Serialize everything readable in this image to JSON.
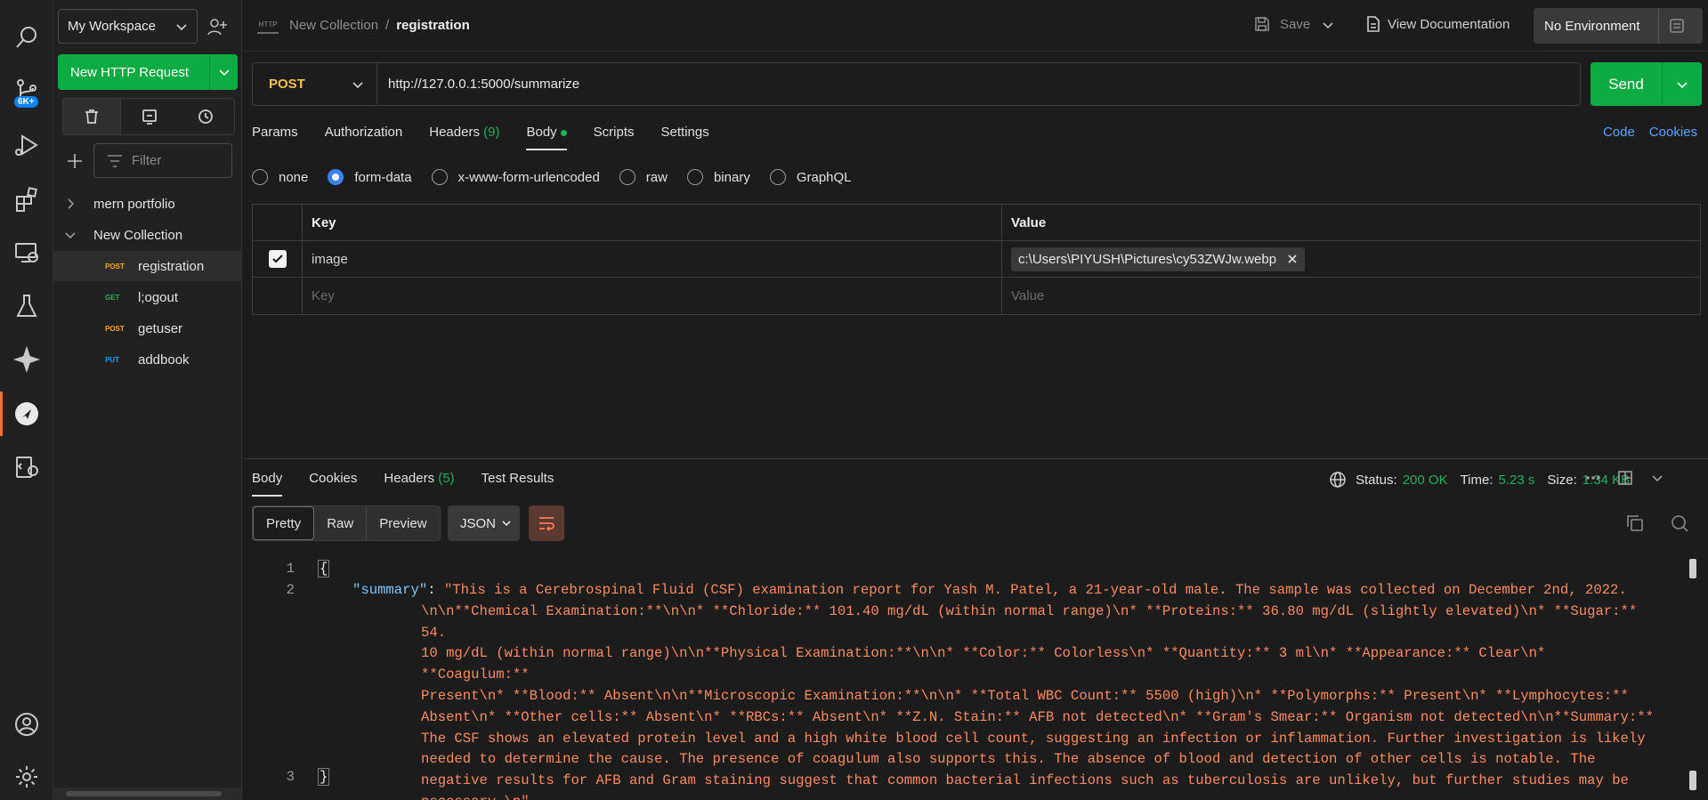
{
  "workspace": {
    "name": "My Workspace",
    "badge": "6K+"
  },
  "sidebar": {
    "new_button": "New HTTP Request",
    "filter_placeholder": "Filter",
    "tree": [
      {
        "type": "collection",
        "name": "mern portfolio",
        "expanded": false
      },
      {
        "type": "collection",
        "name": "New Collection",
        "expanded": true
      },
      {
        "type": "request",
        "method": "POST",
        "name": "registration",
        "selected": true
      },
      {
        "type": "request",
        "method": "GET",
        "name": "l;ogout"
      },
      {
        "type": "request",
        "method": "POST",
        "name": "getuser"
      },
      {
        "type": "request",
        "method": "PUT",
        "name": "addbook"
      }
    ]
  },
  "header": {
    "breadcrumb_icon": "HTTP",
    "collection": "New Collection",
    "separator": "/",
    "request": "registration",
    "save": "Save",
    "view_docs": "View Documentation",
    "environment": "No Environment"
  },
  "request": {
    "method": "POST",
    "url": "http://127.0.0.1:5000/summarize",
    "send": "Send",
    "tabs": {
      "params": "Params",
      "authorization": "Authorization",
      "headers": "Headers",
      "headers_count": "(9)",
      "body": "Body",
      "scripts": "Scripts",
      "settings": "Settings"
    },
    "links": {
      "code": "Code",
      "cookies": "Cookies"
    },
    "body_types": [
      "none",
      "form-data",
      "x-www-form-urlencoded",
      "raw",
      "binary",
      "GraphQL"
    ],
    "body_selected": "form-data",
    "table": {
      "key_header": "Key",
      "value_header": "Value",
      "row_key": "image",
      "row_value": "c:\\Users\\PIYUSH\\Pictures\\cy53ZWJw.webp",
      "key_placeholder": "Key",
      "value_placeholder": "Value"
    }
  },
  "response": {
    "tabs": {
      "body": "Body",
      "cookies": "Cookies",
      "headers": "Headers",
      "headers_count": "(5)",
      "test_results": "Test Results"
    },
    "status_label": "Status:",
    "status_value": "200 OK",
    "time_label": "Time:",
    "time_value": "5.23 s",
    "size_label": "Size:",
    "size_value": "1.34 KB",
    "views": [
      "Pretty",
      "Raw",
      "Preview"
    ],
    "format": "JSON",
    "code": {
      "ln1": "1",
      "ln2": "2",
      "ln3": "3",
      "open": "{",
      "close": "}",
      "key": "\"summary\"",
      "colon": ": ",
      "lines": [
        "\"This is a Cerebrospinal Fluid (CSF) examination report for Yash M. Patel, a 21-year-old male.  The sample was collected on December 2nd, 2022.",
        "\\n\\n**Chemical Examination:**\\n\\n* **Chloride:** 101.40 mg/dL (within normal range)\\n* **Proteins:** 36.80 mg/dL (slightly elevated)\\n* **Sugar:** 54.",
        "10 mg/dL (within normal range)\\n\\n**Physical Examination:**\\n\\n* **Color:** Colorless\\n* **Quantity:** 3 ml\\n* **Appearance:** Clear\\n* **Coagulum:**",
        "Present\\n* **Blood:** Absent\\n\\n**Microscopic Examination:**\\n\\n* **Total WBC Count:** 5500 (high)\\n* **Polymorphs:** Present\\n* **Lymphocytes:**",
        "Absent\\n* **Other cells:** Absent\\n* **RBCs:** Absent\\n* **Z.N. Stain:** AFB not detected\\n* **Gram's Smear:** Organism not detected\\n\\n**Summary:**",
        "The CSF shows an elevated protein level and a high white blood cell count, suggesting an infection or inflammation.  Further investigation is likely",
        "needed to determine the cause.  The presence of coagulum also supports this.  The absence of blood and detection of other cells is notable. The",
        "negative results for AFB and Gram staining suggest that common bacterial infections such as tuberculosis are unlikely, but further studies may be",
        "necessary.\\n\""
      ]
    }
  },
  "colors": {
    "accent": "#ff6c37",
    "send": "#0dab43",
    "post": "#f5c243",
    "get": "#1fb15a",
    "put": "#1a9bff",
    "string": "#ff8a5c",
    "key": "#7cc7ff"
  }
}
